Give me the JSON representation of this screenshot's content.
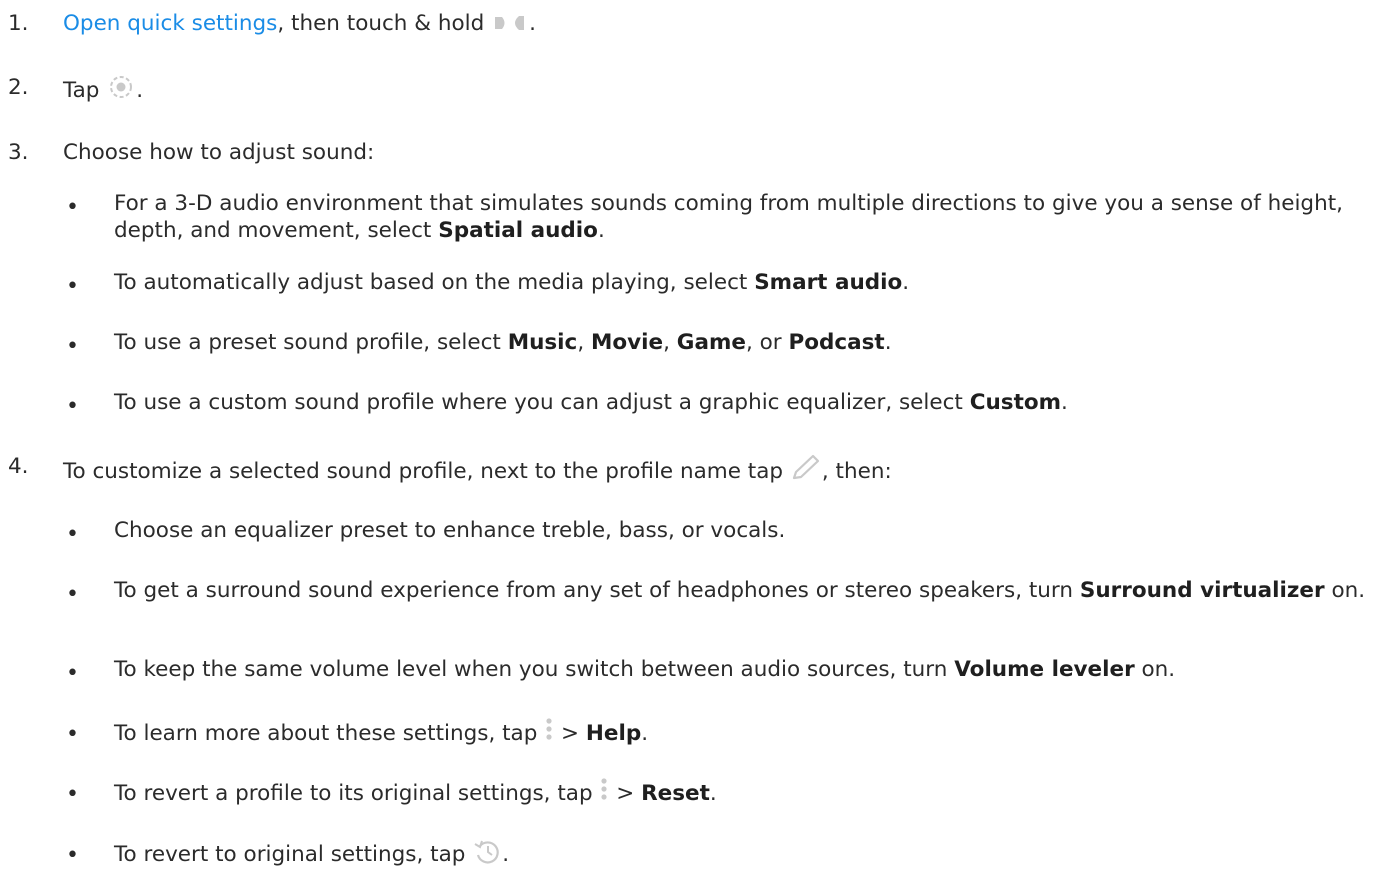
{
  "steps": [
    {
      "number": "1.",
      "link": "Open quick settings",
      "text": ", then touch & hold",
      "after": "."
    },
    {
      "number": "2.",
      "text": "Tap",
      "after": "."
    },
    {
      "number": "3.",
      "text": "Choose how to adjust sound:",
      "bullets": [
        {
          "text_a": "For a 3-D audio environment that simulates sounds coming from multiple directions to give you a sense of height, depth, and movement, select ",
          "bold_a": "Spatial audio",
          "text_b": "."
        },
        {
          "text_a": "To automatically adjust based on the media playing, select ",
          "bold_a": "Smart audio",
          "text_b": "."
        },
        {
          "text_a": "To use a preset sound profile, select ",
          "bold_a": "Music",
          "sep1": ", ",
          "bold_b": "Movie",
          "sep2": ", ",
          "bold_c": "Game",
          "sep3": ", or ",
          "bold_d": "Podcast",
          "text_b": "."
        },
        {
          "text_a": "To use a custom sound profile where you can adjust a graphic equalizer, select ",
          "bold_a": "Custom",
          "text_b": "."
        }
      ]
    },
    {
      "number": "4.",
      "text": "To customize a selected sound profile, next to the profile name tap",
      "after": ", then:",
      "bullets": [
        {
          "text_a": "Choose an equalizer preset to enhance treble, bass, or vocals."
        },
        {
          "text_a": "To get a surround sound experience from any set of headphones or stereo speakers, turn ",
          "bold_a": "Surround virtualizer",
          "text_b": " on."
        },
        {
          "text_a": "To keep the same volume level when you switch between audio sources, turn ",
          "bold_a": "Volume leveler",
          "text_b": " on."
        },
        {
          "text_a": "To learn more about these settings, tap",
          "sep": " > ",
          "bold_a": "Help",
          "text_b": "."
        },
        {
          "text_a": "To revert a profile to its original settings, tap",
          "sep": " > ",
          "bold_a": "Reset",
          "text_b": "."
        },
        {
          "text_a": "To revert to original settings, tap",
          "text_b": "."
        }
      ]
    }
  ],
  "bullet_glyph": "•",
  "icons": {
    "step1": "sound-toggle-icon",
    "step2": "settings-gear-icon",
    "step4": "pencil-edit-icon",
    "more": "more-vert-icon",
    "revert": "history-revert-icon"
  },
  "colors": {
    "link": "#1a8ce6",
    "text": "#2b2b2b",
    "icon": "#c9c9c9"
  }
}
